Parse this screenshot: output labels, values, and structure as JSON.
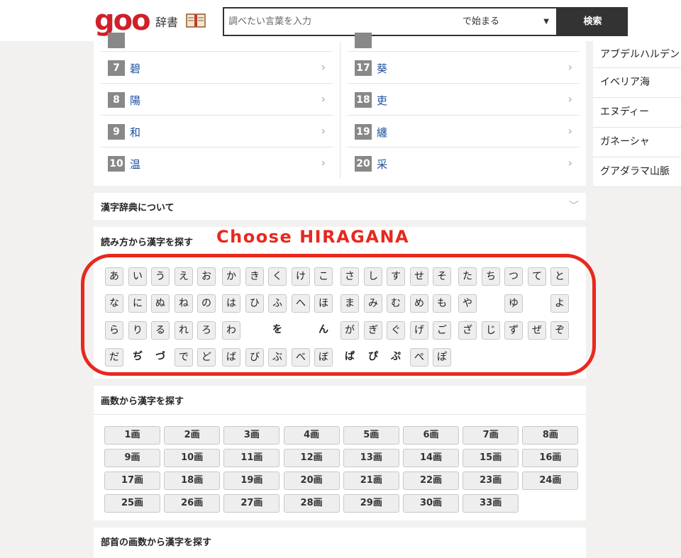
{
  "header": {
    "logo": "goo",
    "site_title": "辞書",
    "search_placeholder": "調べたい言葉を入力",
    "search_mode": "で始まる",
    "search_button": "検索"
  },
  "sidebar": {
    "items": [
      "アブデルハルデン",
      "イベリア海",
      "エヌディー",
      "ガネーシャ",
      "グアダラマ山脈"
    ]
  },
  "ranking": {
    "left": [
      {
        "rank": "7",
        "kanji": "碧"
      },
      {
        "rank": "8",
        "kanji": "陽"
      },
      {
        "rank": "9",
        "kanji": "和"
      },
      {
        "rank": "10",
        "kanji": "温"
      }
    ],
    "right": [
      {
        "rank": "17",
        "kanji": "葵"
      },
      {
        "rank": "18",
        "kanji": "吏"
      },
      {
        "rank": "19",
        "kanji": "纏"
      },
      {
        "rank": "20",
        "kanji": "采"
      }
    ]
  },
  "about": {
    "title": "漢字辞典について"
  },
  "reading": {
    "title": "読み方から漢字を探す",
    "annotation": "Choose HIRAGANA",
    "rows": [
      [
        {
          "k": "あ"
        },
        {
          "k": "い"
        },
        {
          "k": "う"
        },
        {
          "k": "え"
        },
        {
          "k": "お"
        },
        {
          "k": "か"
        },
        {
          "k": "き"
        },
        {
          "k": "く"
        },
        {
          "k": "け"
        },
        {
          "k": "こ"
        },
        {
          "k": "さ"
        },
        {
          "k": "し"
        },
        {
          "k": "す"
        },
        {
          "k": "せ"
        },
        {
          "k": "そ"
        },
        {
          "k": "た"
        },
        {
          "k": "ち"
        },
        {
          "k": "つ"
        },
        {
          "k": "て"
        },
        {
          "k": "と"
        }
      ],
      [
        {
          "k": "な"
        },
        {
          "k": "に"
        },
        {
          "k": "ぬ"
        },
        {
          "k": "ね"
        },
        {
          "k": "の"
        },
        {
          "k": "は"
        },
        {
          "k": "ひ"
        },
        {
          "k": "ふ"
        },
        {
          "k": "へ"
        },
        {
          "k": "ほ"
        },
        {
          "k": "ま"
        },
        {
          "k": "み"
        },
        {
          "k": "む"
        },
        {
          "k": "め"
        },
        {
          "k": "も"
        },
        {
          "k": "や"
        },
        {
          "k": ""
        },
        {
          "k": "ゆ"
        },
        {
          "k": ""
        },
        {
          "k": "よ"
        }
      ],
      [
        {
          "k": "ら"
        },
        {
          "k": "り"
        },
        {
          "k": "る"
        },
        {
          "k": "れ"
        },
        {
          "k": "ろ"
        },
        {
          "k": "わ"
        },
        {
          "k": ""
        },
        {
          "k": "を",
          "plain": true
        },
        {
          "k": ""
        },
        {
          "k": "ん",
          "plain": true
        },
        {
          "k": "が"
        },
        {
          "k": "ぎ"
        },
        {
          "k": "ぐ"
        },
        {
          "k": "げ"
        },
        {
          "k": "ご"
        },
        {
          "k": "ざ"
        },
        {
          "k": "じ"
        },
        {
          "k": "ず"
        },
        {
          "k": "ぜ"
        },
        {
          "k": "ぞ"
        }
      ],
      [
        {
          "k": "だ"
        },
        {
          "k": "ぢ",
          "plain": true
        },
        {
          "k": "づ",
          "plain": true
        },
        {
          "k": "で"
        },
        {
          "k": "ど"
        },
        {
          "k": "ば"
        },
        {
          "k": "び"
        },
        {
          "k": "ぶ"
        },
        {
          "k": "べ"
        },
        {
          "k": "ぼ"
        },
        {
          "k": "ぱ",
          "plain": true
        },
        {
          "k": "ぴ",
          "plain": true
        },
        {
          "k": "ぷ",
          "plain": true
        },
        {
          "k": "ぺ"
        },
        {
          "k": "ぽ"
        }
      ]
    ]
  },
  "strokes": {
    "title": "画数から漢字を探す",
    "buttons": [
      "1画",
      "2画",
      "3画",
      "4画",
      "5画",
      "6画",
      "7画",
      "8画",
      "9画",
      "10画",
      "11画",
      "12画",
      "13画",
      "14画",
      "15画",
      "16画",
      "17画",
      "18画",
      "19画",
      "20画",
      "21画",
      "22画",
      "23画",
      "24画",
      "25画",
      "26画",
      "27画",
      "28画",
      "29画",
      "30画",
      "33画"
    ]
  },
  "radical": {
    "title": "部首の画数から漢字を探す"
  }
}
